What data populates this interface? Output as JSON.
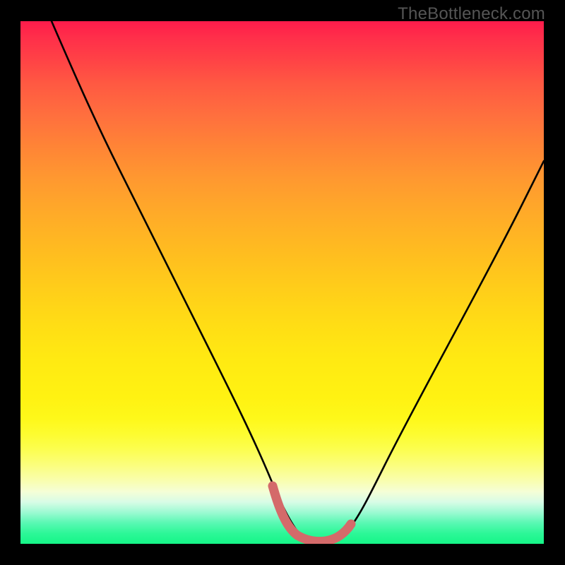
{
  "watermark": {
    "text": "TheBottleneck.com"
  },
  "colors": {
    "background": "#000000",
    "curve": "#000000",
    "trough_marker": "#d46a6a",
    "gradient_top": "#ff1b4b",
    "gradient_bottom": "#15f687"
  },
  "chart_data": {
    "type": "line",
    "title": "",
    "xlabel": "",
    "ylabel": "",
    "xlim": [
      0,
      100
    ],
    "ylim": [
      0,
      100
    ],
    "grid": false,
    "legend": false,
    "series": [
      {
        "name": "curve",
        "x": [
          6,
          10,
          15,
          20,
          25,
          30,
          35,
          40,
          45,
          48,
          50,
          52,
          54,
          56,
          58,
          60,
          62,
          66,
          70,
          75,
          80,
          85,
          90,
          95,
          100
        ],
        "y": [
          100,
          92,
          82,
          72,
          62,
          52,
          42,
          32,
          20,
          11,
          6,
          3,
          1.5,
          1,
          1,
          1.2,
          2,
          5,
          12,
          22,
          32,
          42,
          51,
          59,
          66
        ]
      }
    ],
    "trough_marker": {
      "note": "pink band highlighting the curve minimum region",
      "x_range": [
        49,
        63
      ],
      "y": 2,
      "color": "#d46a6a"
    },
    "background": {
      "note": "vertical red→yellow→green gradient behind the curve"
    }
  }
}
